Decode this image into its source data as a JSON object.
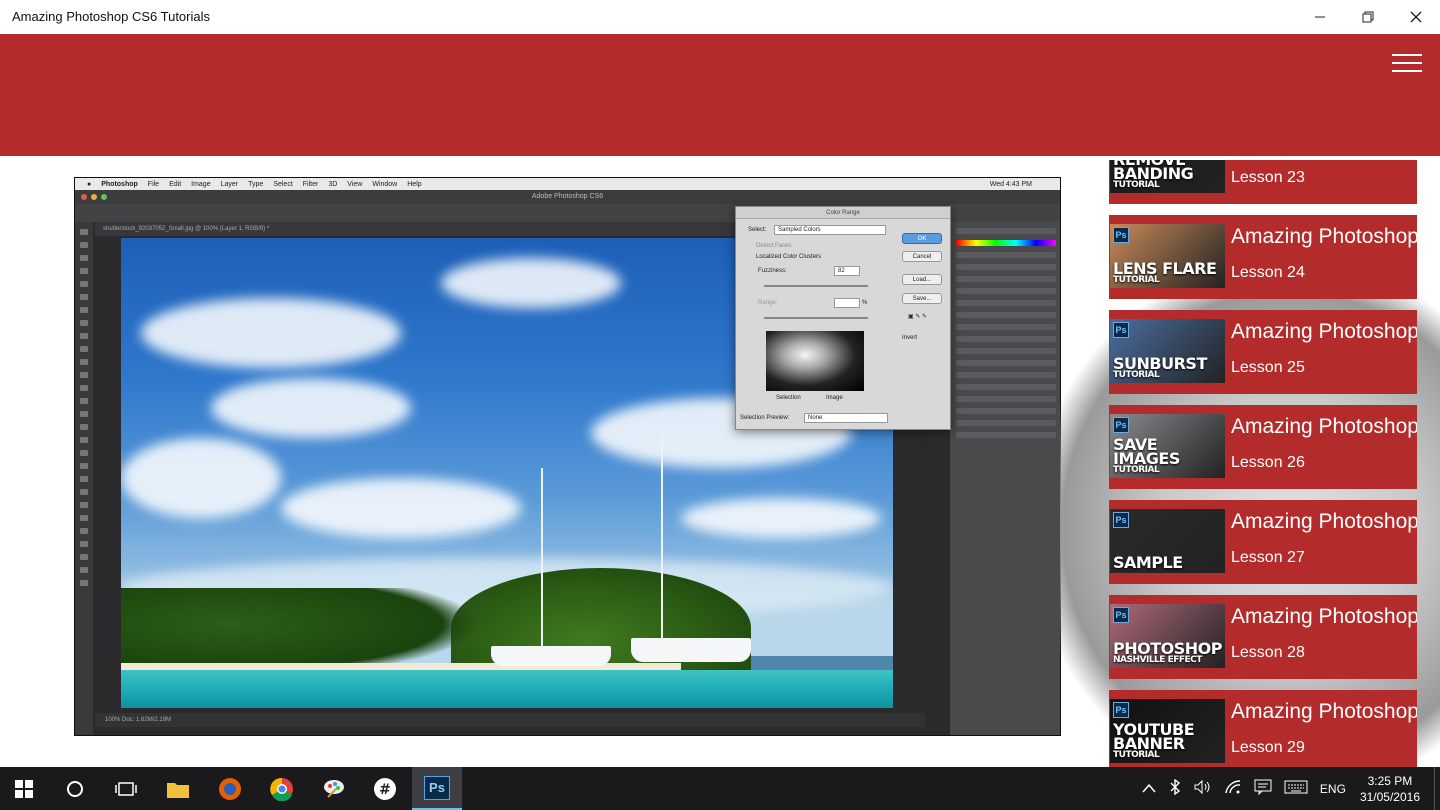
{
  "window": {
    "title": "Amazing Photoshop CS6 Tutorials",
    "controls": {
      "minimize": "—",
      "restore": "❐",
      "close": "✕"
    }
  },
  "header": {
    "menu_icon": "hamburger-icon",
    "bg_color": "#b42b2b"
  },
  "video": {
    "mac_menu": [
      "Photoshop",
      "File",
      "Edit",
      "Image",
      "Layer",
      "Type",
      "Select",
      "Filter",
      "3D",
      "View",
      "Window",
      "Help"
    ],
    "mac_clock": "Wed 4:43 PM",
    "app_title": "Adobe Photoshop CS6",
    "doc_tab": "shutterstock_92037052_Small.jpg @ 100% (Layer 1, RGB/8) *",
    "status": "100%     Doc: 1.62M/2.18M",
    "dialog": {
      "title": "Color Range",
      "select_label": "Select:",
      "select_value": "Sampled Colors",
      "detect_faces": "Detect Faces",
      "localized": "Localized Color Clusters",
      "fuzziness_label": "Fuzziness:",
      "fuzziness_value": "82",
      "range_label": "Range:",
      "range_unit": "%",
      "radio_selection": "Selection",
      "radio_image": "Image",
      "preview_label": "Selection Preview:",
      "preview_value": "None",
      "ok": "OK",
      "cancel": "Cancel",
      "load": "Load...",
      "save": "Save...",
      "invert": "Invert"
    }
  },
  "lessons": [
    {
      "title": "",
      "lesson": "Lesson 23",
      "thumb_text": "REMOVE BANDING",
      "thumb_sub": "TUTORIAL",
      "thumb_color": "#1b1b1b"
    },
    {
      "title": "Amazing Photoshop",
      "lesson": "Lesson 24",
      "thumb_text": "LENS FLARE",
      "thumb_sub": "TUTORIAL",
      "thumb_color": "#c98a5a"
    },
    {
      "title": "Amazing Photoshop",
      "lesson": "Lesson 25",
      "thumb_text": "SUNBURST",
      "thumb_sub": "TUTORIAL",
      "thumb_color": "#4a6fa0"
    },
    {
      "title": "Amazing Photoshop",
      "lesson": "Lesson 26",
      "thumb_text": "SAVE IMAGES",
      "thumb_sub": "TUTORIAL",
      "thumb_color": "#8c8a8e"
    },
    {
      "title": "Amazing Photoshop",
      "lesson": "Lesson 27",
      "thumb_text": "SAMPLE",
      "thumb_sub": "",
      "thumb_color": "#2a2a2a"
    },
    {
      "title": "Amazing Photoshop",
      "lesson": "Lesson 28",
      "thumb_text": "PHOTOSHOP",
      "thumb_sub": "NASHVILLE EFFECT",
      "thumb_color": "#b06a7a"
    },
    {
      "title": "Amazing Photoshop",
      "lesson": "Lesson 29",
      "thumb_text": "YOUTUBE BANNER",
      "thumb_sub": "TUTORIAL",
      "thumb_color": "#111111"
    }
  ],
  "taskbar": {
    "apps": [
      "windows-start-icon",
      "cortana-icon",
      "task-view-icon",
      "file-explorer-icon",
      "firefox-icon",
      "chrome-icon",
      "paint-icon",
      "slack-icon",
      "photoshop-icon"
    ],
    "ps_label": "Ps",
    "tray": {
      "language": "ENG",
      "time": "3:25 PM",
      "date": "31/05/2016"
    }
  }
}
